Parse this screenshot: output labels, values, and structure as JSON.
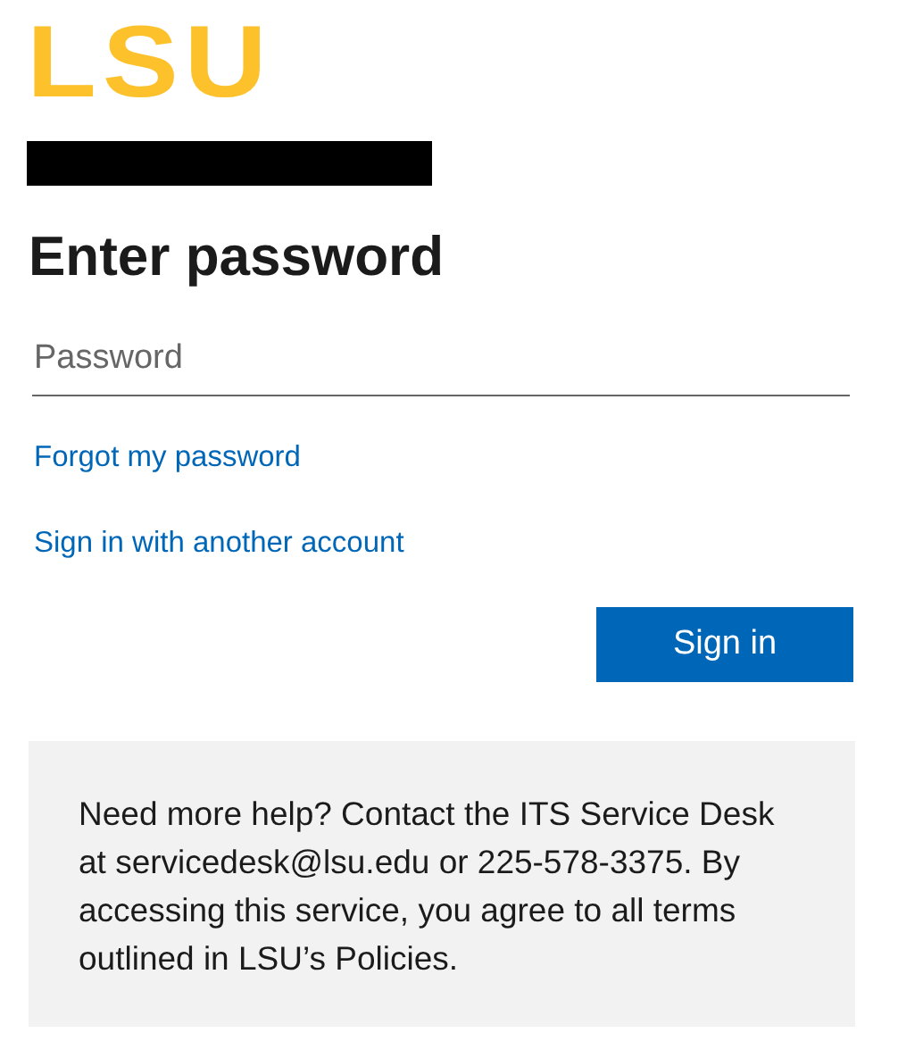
{
  "logo": {
    "text": "LSU"
  },
  "heading": "Enter password",
  "password_field": {
    "placeholder": "Password"
  },
  "links": [
    "Forgot my password",
    "Sign in with another account"
  ],
  "sign_in_button": "Sign in",
  "help_text": "Need more help? Contact the ITS Service Desk at servicedesk@lsu.edu or 225-578-3375. By accessing this service, you agree to all terms outlined in LSU’s Policies."
}
